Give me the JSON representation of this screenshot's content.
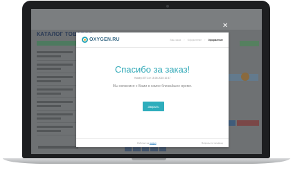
{
  "background_site": {
    "catalog_title": "КАТАЛОГ ТОВАРОВ"
  },
  "modal": {
    "logo_text": "OXYGEN.RU",
    "steps": [
      "Ваш заказ",
      "Оформление",
      "Оформление"
    ],
    "title": "Спасибо за заказ!",
    "order_line": "Номер 8771 от 15.05.2015 10:37",
    "message": "Мы свяжемся с Вами в самое ближайшее время.",
    "button_label": "Закрыть",
    "footer_text": "Работает на",
    "footer_link": "oxygen",
    "footer_right": "Вопросы по телефону",
    "close_symbol": "✕"
  },
  "colors": {
    "accent": "#2aa6b5",
    "button": "#2eadbc",
    "laptop_frame": "#1d1e20"
  }
}
